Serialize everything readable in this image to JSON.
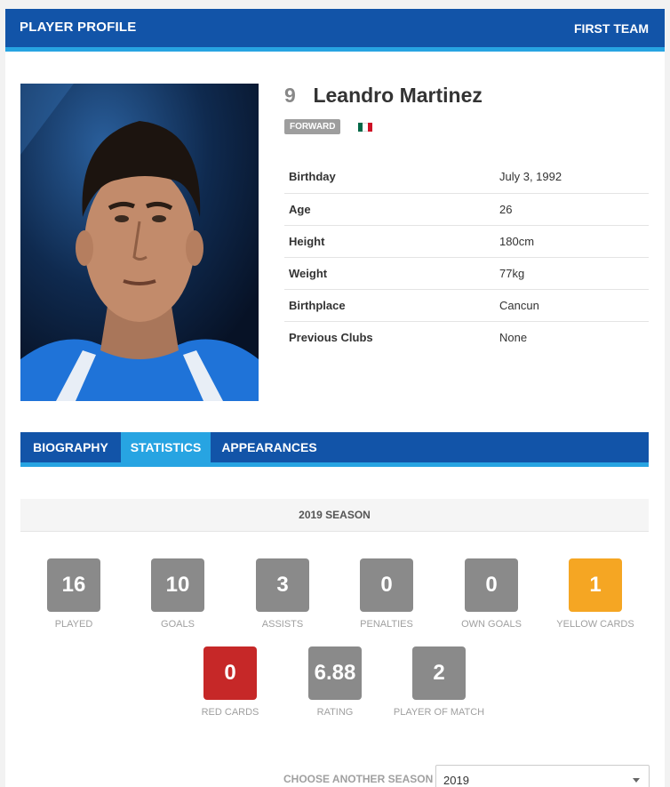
{
  "topbar": {
    "title": "PLAYER PROFILE",
    "team_label": "FIRST TEAM"
  },
  "player": {
    "number": "9",
    "name": "Leandro Martinez",
    "position": "FORWARD",
    "flag_icon": "mexico-flag-icon",
    "flag_colors": [
      "#006847",
      "#ffffff",
      "#ce1126"
    ]
  },
  "info": [
    {
      "label": "Birthday",
      "value": "July 3, 1992"
    },
    {
      "label": "Age",
      "value": "26"
    },
    {
      "label": "Height",
      "value": "180cm"
    },
    {
      "label": "Weight",
      "value": "77kg"
    },
    {
      "label": "Birthplace",
      "value": "Cancun"
    },
    {
      "label": "Previous Clubs",
      "value": "None"
    }
  ],
  "tabs": [
    {
      "label": "BIOGRAPHY",
      "active": false
    },
    {
      "label": "STATISTICS",
      "active": true
    },
    {
      "label": "APPEARANCES",
      "active": false
    }
  ],
  "season": {
    "heading": "2019 SEASON"
  },
  "stats": [
    {
      "value": "16",
      "label": "PLAYED",
      "color": "#8a8a8a"
    },
    {
      "value": "10",
      "label": "GOALS",
      "color": "#8a8a8a"
    },
    {
      "value": "3",
      "label": "ASSISTS",
      "color": "#8a8a8a"
    },
    {
      "value": "0",
      "label": "PENALTIES",
      "color": "#8a8a8a"
    },
    {
      "value": "0",
      "label": "OWN GOALS",
      "color": "#8a8a8a"
    },
    {
      "value": "1",
      "label": "YELLOW CARDS",
      "color": "#f5a623"
    },
    {
      "value": "0",
      "label": "RED CARDS",
      "color": "#c62828"
    },
    {
      "value": "6.88",
      "label": "RATING",
      "color": "#8a8a8a"
    },
    {
      "value": "2",
      "label": "PLAYER OF MATCH",
      "color": "#8a8a8a"
    }
  ],
  "season_select": {
    "label": "CHOOSE ANOTHER SEASON",
    "value": "2019"
  },
  "colors": {
    "brand": "#1254a8",
    "accent": "#27a4e2"
  }
}
